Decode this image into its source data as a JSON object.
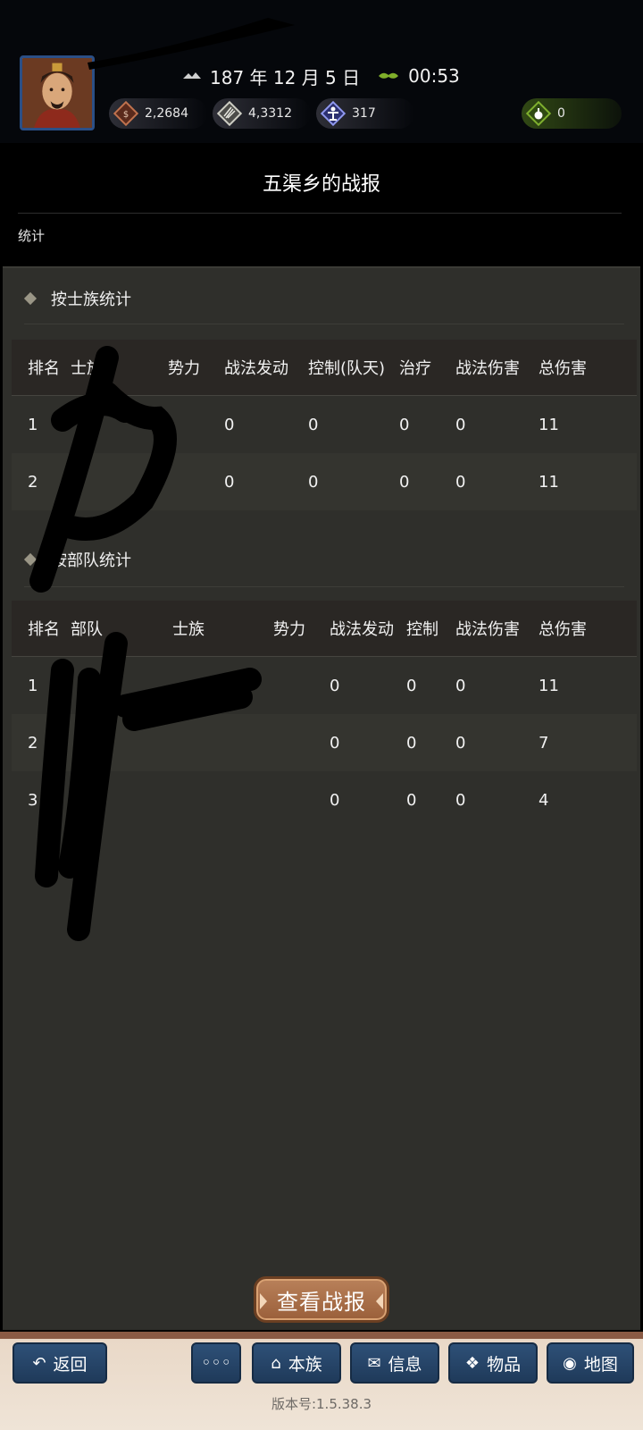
{
  "header": {
    "date": "187 年 12 月 5 日",
    "time": "00:53",
    "resources": [
      {
        "icon": "coin-icon",
        "value": "2,2684"
      },
      {
        "icon": "grain-icon",
        "value": "4,3312"
      },
      {
        "icon": "strength-icon",
        "value": "317"
      },
      {
        "icon": "potion-icon",
        "value": "0"
      }
    ]
  },
  "page": {
    "title": "五渠乡的战报",
    "tab": "统计"
  },
  "clan_stats": {
    "heading": "按士族统计",
    "columns": [
      "排名",
      "士族",
      "势力",
      "战法发动",
      "控制(队天)",
      "治疗",
      "战法伤害",
      "总伤害"
    ],
    "rows": [
      {
        "rank": "1",
        "clan": "",
        "force": "",
        "skill": "0",
        "control": "0",
        "heal": "0",
        "skill_dmg": "0",
        "total": "11"
      },
      {
        "rank": "2",
        "clan": "",
        "force": "",
        "skill": "0",
        "control": "0",
        "heal": "0",
        "skill_dmg": "0",
        "total": "11"
      }
    ]
  },
  "troop_stats": {
    "heading": "按部队统计",
    "columns": [
      "排名",
      "部队",
      "士族",
      "势力",
      "战法发动",
      "控制",
      "战法伤害",
      "总伤害"
    ],
    "rows": [
      {
        "rank": "1",
        "troop": "",
        "clan": "",
        "force": "",
        "skill": "0",
        "control": "0",
        "skill_dmg": "0",
        "total": "11"
      },
      {
        "rank": "2",
        "troop": "",
        "clan": "",
        "force": "",
        "skill": "0",
        "control": "0",
        "skill_dmg": "0",
        "total": "7"
      },
      {
        "rank": "3",
        "troop": "",
        "clan": "",
        "force": "",
        "skill": "0",
        "control": "0",
        "skill_dmg": "0",
        "total": "4"
      }
    ]
  },
  "actions": {
    "view_report": "查看战报"
  },
  "nav": {
    "back": "返回",
    "more": "◦◦◦",
    "clan": "本族",
    "info": "信息",
    "items": "物品",
    "map": "地图"
  },
  "version": "版本号:1.5.38.3"
}
